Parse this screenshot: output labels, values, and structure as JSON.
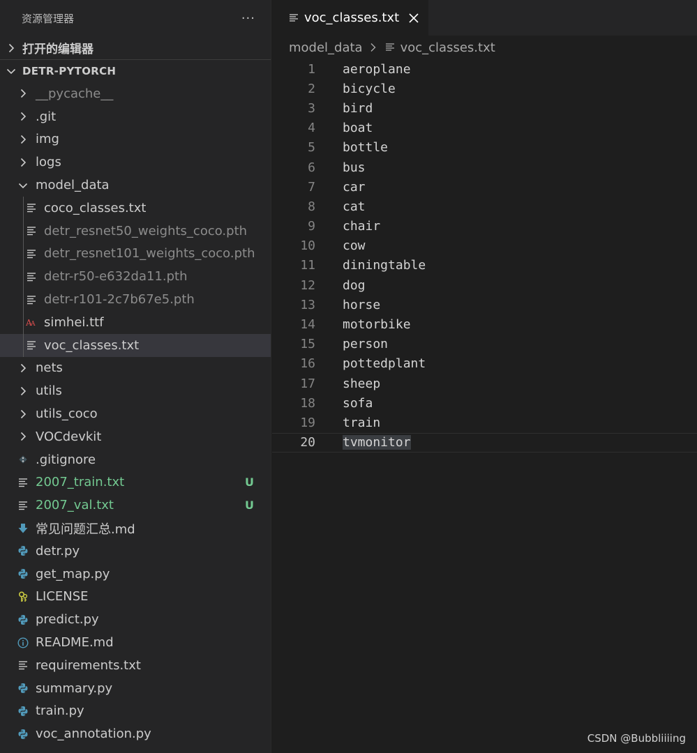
{
  "sidebar": {
    "title": "资源管理器",
    "more": "···",
    "open_editors": "打开的编辑器",
    "project": "DETR-PYTORCH"
  },
  "tree": [
    {
      "label": "__pycache__",
      "type": "folder",
      "open": false,
      "depth": 1,
      "style": "dim",
      "icon": "chevron-right-icon"
    },
    {
      "label": ".git",
      "type": "folder",
      "open": false,
      "depth": 1,
      "icon": "chevron-right-icon"
    },
    {
      "label": "img",
      "type": "folder",
      "open": false,
      "depth": 1,
      "icon": "chevron-right-icon"
    },
    {
      "label": "logs",
      "type": "folder",
      "open": false,
      "depth": 1,
      "icon": "chevron-right-icon"
    },
    {
      "label": "model_data",
      "type": "folder",
      "open": true,
      "depth": 1,
      "icon": "chevron-down-icon"
    },
    {
      "label": "coco_classes.txt",
      "type": "file",
      "depth": 2,
      "icon": "text-file-icon"
    },
    {
      "label": "detr_resnet50_weights_coco.pth",
      "type": "file",
      "depth": 2,
      "style": "dim",
      "icon": "text-file-icon"
    },
    {
      "label": "detr_resnet101_weights_coco.pth",
      "type": "file",
      "depth": 2,
      "style": "dim",
      "icon": "text-file-icon"
    },
    {
      "label": "detr-r50-e632da11.pth",
      "type": "file",
      "depth": 2,
      "style": "dim",
      "icon": "text-file-icon"
    },
    {
      "label": "detr-r101-2c7b67e5.pth",
      "type": "file",
      "depth": 2,
      "style": "dim",
      "icon": "text-file-icon"
    },
    {
      "label": "simhei.ttf",
      "type": "file",
      "depth": 2,
      "icon": "font-file-icon"
    },
    {
      "label": "voc_classes.txt",
      "type": "file",
      "depth": 2,
      "selected": true,
      "icon": "text-file-icon"
    },
    {
      "label": "nets",
      "type": "folder",
      "open": false,
      "depth": 1,
      "icon": "chevron-right-icon"
    },
    {
      "label": "utils",
      "type": "folder",
      "open": false,
      "depth": 1,
      "icon": "chevron-right-icon"
    },
    {
      "label": "utils_coco",
      "type": "folder",
      "open": false,
      "depth": 1,
      "icon": "chevron-right-icon"
    },
    {
      "label": "VOCdevkit",
      "type": "folder",
      "open": false,
      "depth": 1,
      "icon": "chevron-right-icon"
    },
    {
      "label": ".gitignore",
      "type": "file",
      "depth": 1,
      "icon": "git-icon"
    },
    {
      "label": "2007_train.txt",
      "type": "file",
      "depth": 1,
      "style": "green",
      "badge": "U",
      "icon": "text-file-icon"
    },
    {
      "label": "2007_val.txt",
      "type": "file",
      "depth": 1,
      "style": "green",
      "badge": "U",
      "icon": "text-file-icon"
    },
    {
      "label": "常见问题汇总.md",
      "type": "file",
      "depth": 1,
      "icon": "markdown-download-icon"
    },
    {
      "label": "detr.py",
      "type": "file",
      "depth": 1,
      "icon": "python-icon"
    },
    {
      "label": "get_map.py",
      "type": "file",
      "depth": 1,
      "icon": "python-icon"
    },
    {
      "label": "LICENSE",
      "type": "file",
      "depth": 1,
      "icon": "license-icon"
    },
    {
      "label": "predict.py",
      "type": "file",
      "depth": 1,
      "icon": "python-icon"
    },
    {
      "label": "README.md",
      "type": "file",
      "depth": 1,
      "icon": "info-icon"
    },
    {
      "label": "requirements.txt",
      "type": "file",
      "depth": 1,
      "icon": "text-file-icon"
    },
    {
      "label": "summary.py",
      "type": "file",
      "depth": 1,
      "icon": "python-icon"
    },
    {
      "label": "train.py",
      "type": "file",
      "depth": 1,
      "icon": "python-icon"
    },
    {
      "label": "voc_annotation.py",
      "type": "file",
      "depth": 1,
      "icon": "python-icon"
    }
  ],
  "editor": {
    "tab_label": "voc_classes.txt",
    "breadcrumb": [
      "model_data",
      "voc_classes.txt"
    ],
    "current_line": 20,
    "lines": [
      "aeroplane",
      "bicycle",
      "bird",
      "boat",
      "bottle",
      "bus",
      "car",
      "cat",
      "chair",
      "cow",
      "diningtable",
      "dog",
      "horse",
      "motorbike",
      "person",
      "pottedplant",
      "sheep",
      "sofa",
      "train",
      "tvmonitor"
    ]
  },
  "watermark": "CSDN @Bubbliiiing",
  "colors": {
    "background": "#1e1e1e",
    "sidebar": "#252526",
    "selected": "#37373d",
    "untracked": "#73c991",
    "python": "#519aba",
    "font": "#e04f4f",
    "license": "#cbcb41",
    "markdown": "#519aba"
  }
}
